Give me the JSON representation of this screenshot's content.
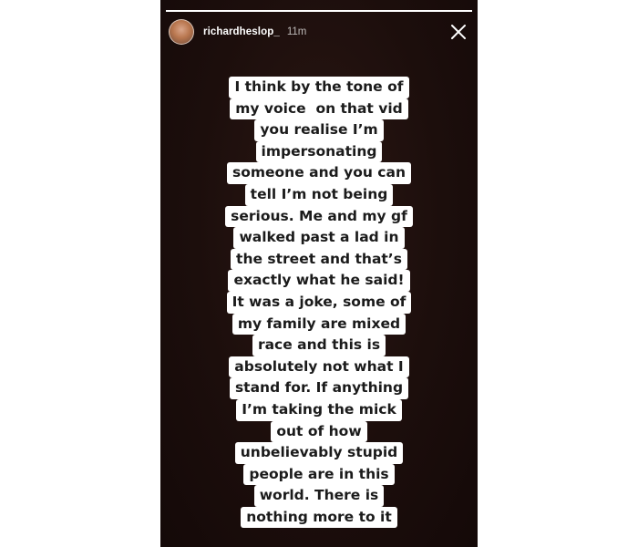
{
  "story": {
    "username": "richardheslop_",
    "time": "11m",
    "progress": 1.0,
    "close_icon": "close-icon",
    "caption_lines": [
      "I think by the tone of",
      "my voice  on that vid",
      "you realise I’m",
      "impersonating",
      "someone and you can",
      "tell I’m not being",
      "serious. Me and my gf",
      "walked past a lad in",
      "the street and that’s",
      "exactly what he said!",
      "It was a joke, some of",
      "my family are mixed",
      "race and this is",
      "absolutely not what I",
      "stand for. If anything",
      "I’m taking the mick",
      "out of how",
      "unbelievably stupid",
      "people are in this",
      "world. There is",
      "nothing more to it"
    ]
  }
}
